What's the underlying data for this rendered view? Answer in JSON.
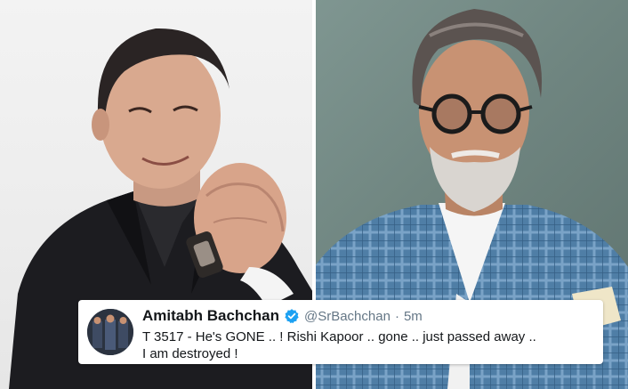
{
  "tweet": {
    "author_name": "Amitabh Bachchan",
    "verified": true,
    "handle": "@SrBachchan",
    "separator": "·",
    "time": "5m",
    "text_line1": "T 3517 - He's GONE .. ! Rishi Kapoor .. gone .. just passed away ..",
    "text_line2": "I am destroyed !"
  },
  "colors": {
    "verified_badge": "#1da1f2",
    "card_background": "#ffffff",
    "handle_text": "#657786"
  }
}
